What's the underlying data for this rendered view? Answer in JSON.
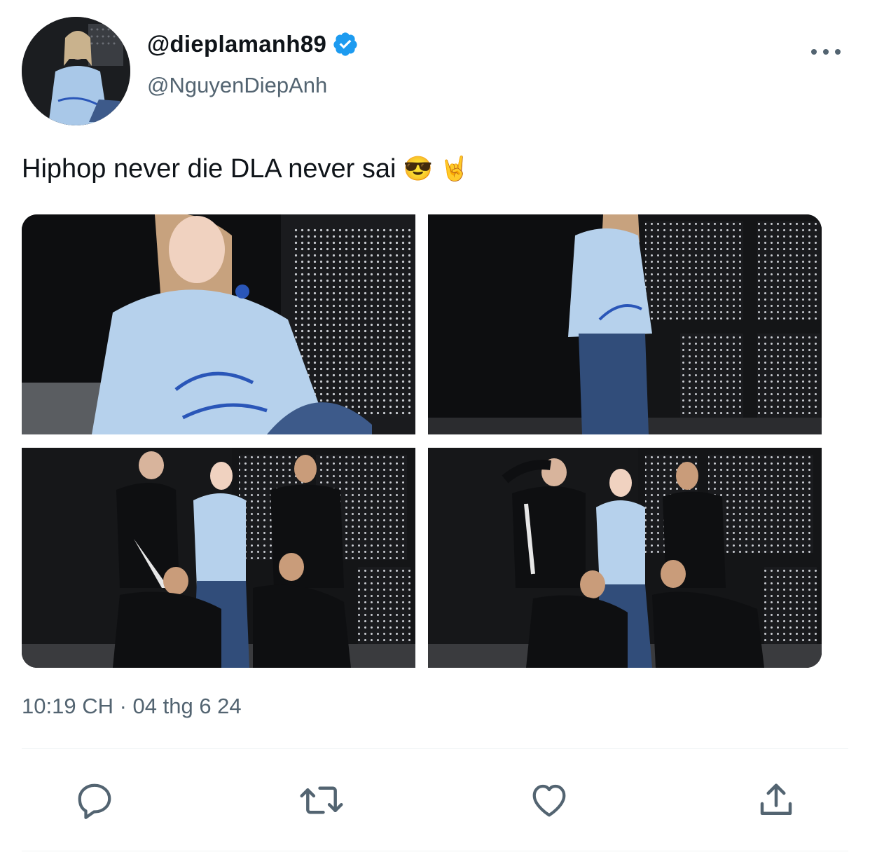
{
  "author": {
    "display_name": "@dieplamanh89",
    "handle": "@NguyenDiepAnh",
    "verified": true,
    "verified_color": "#1d9bf0"
  },
  "tweet": {
    "text": "Hiphop never die DLA never sai",
    "emojis": [
      "😎",
      "🤘"
    ],
    "timestamp": "10:19 CH · 04 thg 6 24",
    "photo_count": 4
  },
  "icons": {
    "more": "more-horizontal-icon",
    "reply": "reply-icon",
    "retweet": "retweet-icon",
    "like": "heart-icon",
    "share": "share-icon"
  },
  "colors": {
    "text": "#0f1419",
    "secondary": "#536471",
    "divider": "#eff3f4",
    "shirt_blue": "#a9c8e8"
  }
}
